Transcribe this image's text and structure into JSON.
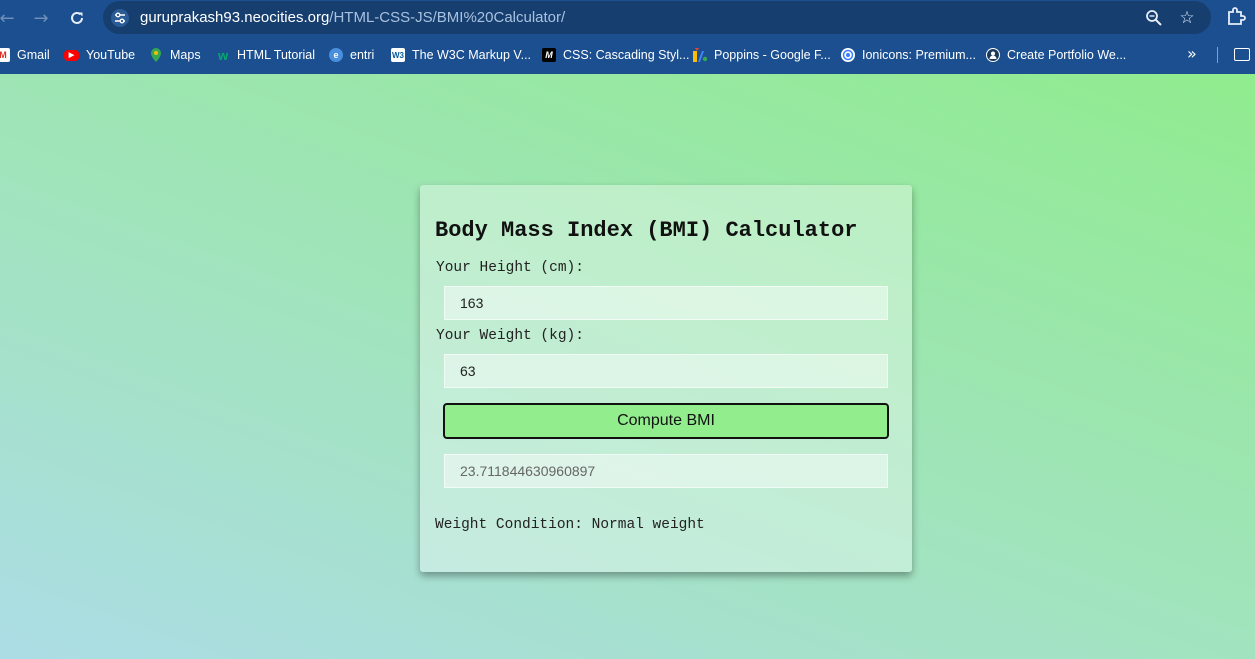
{
  "browser": {
    "url_host": "guruprakash93.neocities.org",
    "url_path": "/HTML-CSS-JS/BMI%20Calculator/",
    "bookmarks": [
      {
        "label": "Gmail",
        "icon": "gmail-icon"
      },
      {
        "label": "YouTube",
        "icon": "youtube-icon"
      },
      {
        "label": "Maps",
        "icon": "maps-icon"
      },
      {
        "label": "HTML Tutorial",
        "icon": "w3schools-icon"
      },
      {
        "label": "entri",
        "icon": "entri-icon"
      },
      {
        "label": "The W3C Markup V...",
        "icon": "w3c-icon"
      },
      {
        "label": "CSS: Cascading Styl...",
        "icon": "mdn-icon"
      },
      {
        "label": "Poppins - Google F...",
        "icon": "google-fonts-icon"
      },
      {
        "label": "Ionicons: Premium...",
        "icon": "ionicons-icon"
      },
      {
        "label": "Create Portfolio We...",
        "icon": "portfolio-icon"
      }
    ]
  },
  "app": {
    "title": "Body Mass Index (BMI) Calculator",
    "height_label": "Your Height (cm):",
    "height_value": "163",
    "weight_label": "Your Weight (kg):",
    "weight_value": "63",
    "compute_label": "Compute BMI",
    "bmi_result": "23.711844630960897",
    "condition_label": "Weight Condition:",
    "condition_value": "Normal weight"
  },
  "colors": {
    "browser_bar": "#1b4f8f",
    "button": "#92ee8d",
    "gradient_start": "#acdde6",
    "gradient_end": "#90ec8e"
  }
}
